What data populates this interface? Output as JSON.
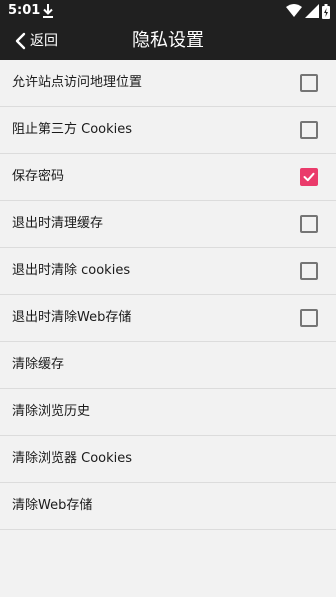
{
  "status_bar": {
    "time": "5:01",
    "icons": [
      "download-icon",
      "wifi-icon",
      "cellular-signal-icon",
      "battery-charging-icon"
    ]
  },
  "header": {
    "back_label": "返回",
    "title": "隐私设置"
  },
  "colors": {
    "header_bg": "#202020",
    "accent": "#ea3b6b",
    "list_bg": "#f2f2f2"
  },
  "settings": [
    {
      "label": "允许站点访问地理位置",
      "type": "checkbox",
      "checked": false
    },
    {
      "label": "阻止第三方 Cookies",
      "type": "checkbox",
      "checked": false
    },
    {
      "label": "保存密码",
      "type": "checkbox",
      "checked": true
    },
    {
      "label": "退出时清理缓存",
      "type": "checkbox",
      "checked": false
    },
    {
      "label": "退出时清除 cookies",
      "type": "checkbox",
      "checked": false
    },
    {
      "label": "退出时清除Web存储",
      "type": "checkbox",
      "checked": false
    },
    {
      "label": "清除缓存",
      "type": "action"
    },
    {
      "label": "清除浏览历史",
      "type": "action"
    },
    {
      "label": "清除浏览器 Cookies",
      "type": "action"
    },
    {
      "label": "清除Web存储",
      "type": "action"
    }
  ]
}
